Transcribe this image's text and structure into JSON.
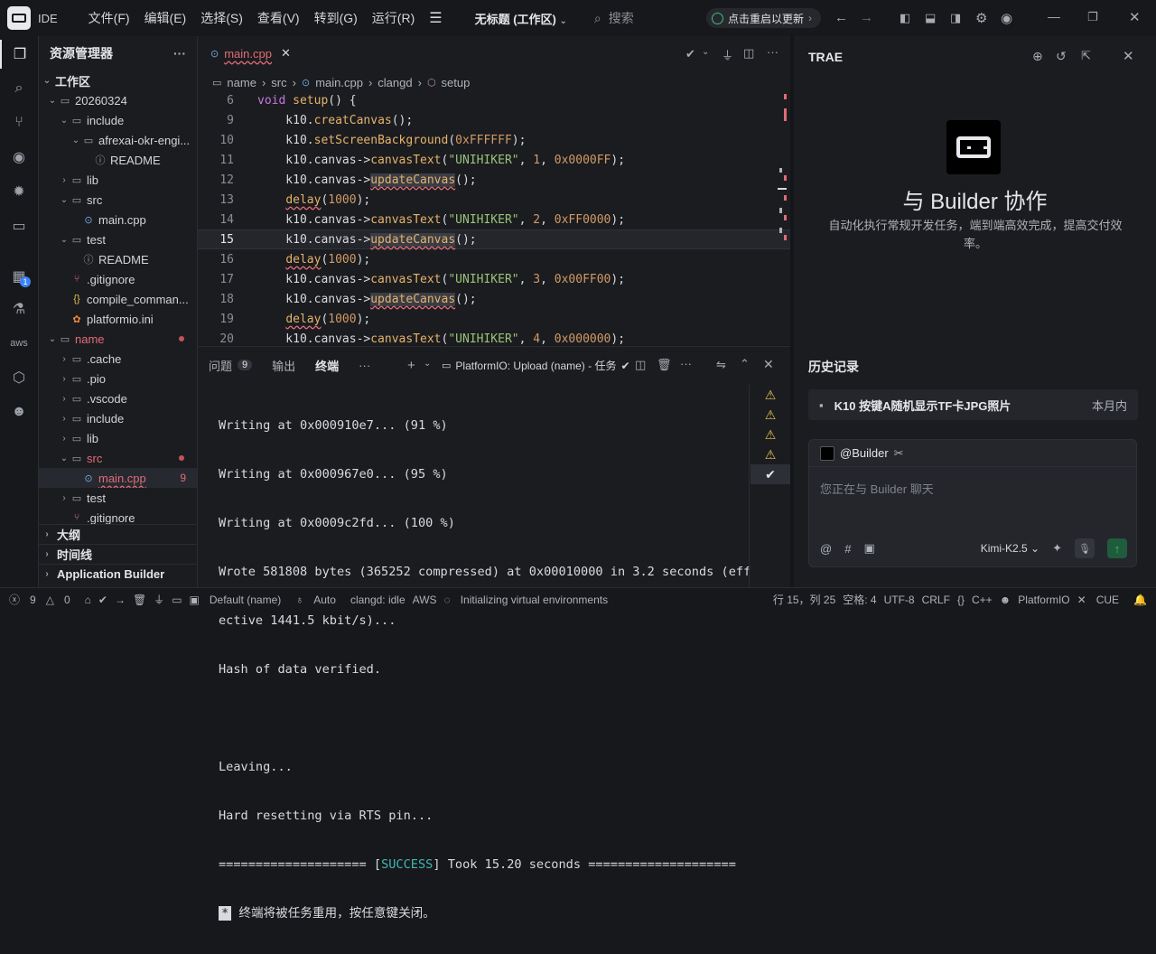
{
  "titlebar": {
    "ide_tag": "IDE",
    "menu": [
      "文件(F)",
      "编辑(E)",
      "选择(S)",
      "查看(V)",
      "转到(G)",
      "运行(R)"
    ],
    "workspace_title": "无标题 (工作区)",
    "search_placeholder": "搜索",
    "update_label": "点击重启以更新"
  },
  "explorer": {
    "title": "资源管理器",
    "section": "工作区",
    "tree": [
      {
        "label": "20260324",
        "icon": "folder",
        "level": 0,
        "chev": "v"
      },
      {
        "label": "include",
        "icon": "folder",
        "level": 1,
        "chev": "v"
      },
      {
        "label": "afrexai-okr-engi...",
        "icon": "folder",
        "level": 2,
        "chev": "v"
      },
      {
        "label": "README",
        "icon": "info",
        "level": 3,
        "chev": ""
      },
      {
        "label": "lib",
        "icon": "folder",
        "level": 1,
        "chev": ">"
      },
      {
        "label": "src",
        "icon": "folder",
        "level": 1,
        "chev": "v"
      },
      {
        "label": "main.cpp",
        "icon": "cpp",
        "level": 2,
        "chev": ""
      },
      {
        "label": "test",
        "icon": "folder",
        "level": 1,
        "chev": "v"
      },
      {
        "label": "README",
        "icon": "info",
        "level": 2,
        "chev": ""
      },
      {
        "label": ".gitignore",
        "icon": "git",
        "level": 1,
        "chev": ""
      },
      {
        "label": "compile_comman...",
        "icon": "json",
        "level": 1,
        "chev": ""
      },
      {
        "label": "platformio.ini",
        "icon": "pio",
        "level": 1,
        "chev": ""
      },
      {
        "label": "name",
        "icon": "folder",
        "level": 0,
        "chev": "v",
        "red": true
      },
      {
        "label": ".cache",
        "icon": "folder",
        "level": 1,
        "chev": ">"
      },
      {
        "label": ".pio",
        "icon": "folder",
        "level": 1,
        "chev": ">"
      },
      {
        "label": ".vscode",
        "icon": "folder",
        "level": 1,
        "chev": ">"
      },
      {
        "label": "include",
        "icon": "folder",
        "level": 1,
        "chev": ">"
      },
      {
        "label": "lib",
        "icon": "folder",
        "level": 1,
        "chev": ">"
      },
      {
        "label": "src",
        "icon": "folder",
        "level": 1,
        "chev": "v",
        "red": true
      },
      {
        "label": "main.cpp",
        "icon": "cpp",
        "level": 2,
        "chev": "",
        "red": true,
        "count": "9",
        "selected": true
      },
      {
        "label": "test",
        "icon": "folder",
        "level": 1,
        "chev": ">"
      },
      {
        "label": ".gitignore",
        "icon": "git",
        "level": 1,
        "chev": ""
      }
    ],
    "sections": [
      "大纲",
      "时间线",
      "Application Builder"
    ]
  },
  "editor": {
    "tab_label": "main.cpp",
    "breadcrumb": [
      "name",
      "src",
      "main.cpp",
      "clangd",
      "setup"
    ],
    "lines": [
      {
        "num": "6",
        "html": "<span class='k'>void</span> <span class='fn'>setup</span>() {"
      },
      {
        "num": "9",
        "html": "    k10.<span class='fn'>creatCanvas</span>();"
      },
      {
        "num": "10",
        "html": "    k10.<span class='fn'>setScreenBackground</span>(<span class='n'>0xFFFFFF</span>);"
      },
      {
        "num": "11",
        "html": "    k10.canvas-><span class='fn'>canvasText</span>(<span class='s'>\"UNIHIKER\"</span>, <span class='n'>1</span>, <span class='n'>0x0000FF</span>);"
      },
      {
        "num": "12",
        "html": "    k10.canvas-><span class='fn sq hl'>updateCanvas</span>();"
      },
      {
        "num": "13",
        "html": "    <span class='fn sq'>delay</span>(<span class='n'>1000</span>);"
      },
      {
        "num": "14",
        "html": "    k10.canvas-><span class='fn'>canvasText</span>(<span class='s'>\"UNIHIKER\"</span>, <span class='n'>2</span>, <span class='n'>0xFF0000</span>);"
      },
      {
        "num": "15",
        "html": "    k10.canvas-><span class='fn sq hl'>updateCanvas</span>();",
        "current": true
      },
      {
        "num": "16",
        "html": "    <span class='fn sq'>delay</span>(<span class='n'>1000</span>);"
      },
      {
        "num": "17",
        "html": "    k10.canvas-><span class='fn'>canvasText</span>(<span class='s'>\"UNIHIKER\"</span>, <span class='n'>3</span>, <span class='n'>0x00FF00</span>);"
      },
      {
        "num": "18",
        "html": "    k10.canvas-><span class='fn sq hl'>updateCanvas</span>();"
      },
      {
        "num": "19",
        "html": "    <span class='fn sq'>delay</span>(<span class='n'>1000</span>);"
      },
      {
        "num": "20",
        "html": "    k10.canvas-><span class='fn'>canvasText</span>(<span class='s'>\"UNIHIKER\"</span>, <span class='n'>4</span>, <span class='n'>0x000000</span>);"
      }
    ]
  },
  "panel": {
    "tabs": {
      "problems": "问题",
      "problems_count": "9",
      "output": "输出",
      "terminal": "终端"
    },
    "task_label": "PlatformIO: Upload (name) - 任务",
    "terminal_lines": [
      "Writing at 0x000910e7... (91 %)",
      "Writing at 0x000967e0... (95 %)",
      "Writing at 0x0009c2fd... (100 %)",
      "Wrote 581808 bytes (365252 compressed) at 0x00010000 in 3.2 seconds (eff",
      "ective 1441.5 kbit/s)...",
      "Hash of data verified.",
      "",
      "Leaving...",
      "Hard resetting via RTS pin..."
    ],
    "success_prefix": "==================== [",
    "success_word": "SUCCESS",
    "success_suffix": "] Took 15.20 seconds ====================",
    "reuse_mark": "*",
    "reuse_text": " 终端将被任务重用，按任意键关闭。"
  },
  "right": {
    "title": "TRAE",
    "builder_title": "与 Builder 协作",
    "builder_desc": "自动化执行常规开发任务，端到端高效完成，提高交付效率。",
    "history_title": "历史记录",
    "history_item": "K10 按键A随机显示TF卡JPG照片",
    "history_date": "本月内",
    "chat_mention": "@Builder",
    "chat_placeholder": "您正在与 Builder 聊天",
    "model": "Kimi-K2.5"
  },
  "status": {
    "errors": "9",
    "warnings": "0",
    "env": "Default (name)",
    "auto": "Auto",
    "clangd": "clangd: idle",
    "aws": "AWS",
    "init": "Initializing virtual environments",
    "pos": "行 15，列 25",
    "spaces": "空格: 4",
    "encoding": "UTF-8",
    "eol": "CRLF",
    "lang": "C++",
    "pio": "PlatformIO",
    "cue": "CUE"
  }
}
